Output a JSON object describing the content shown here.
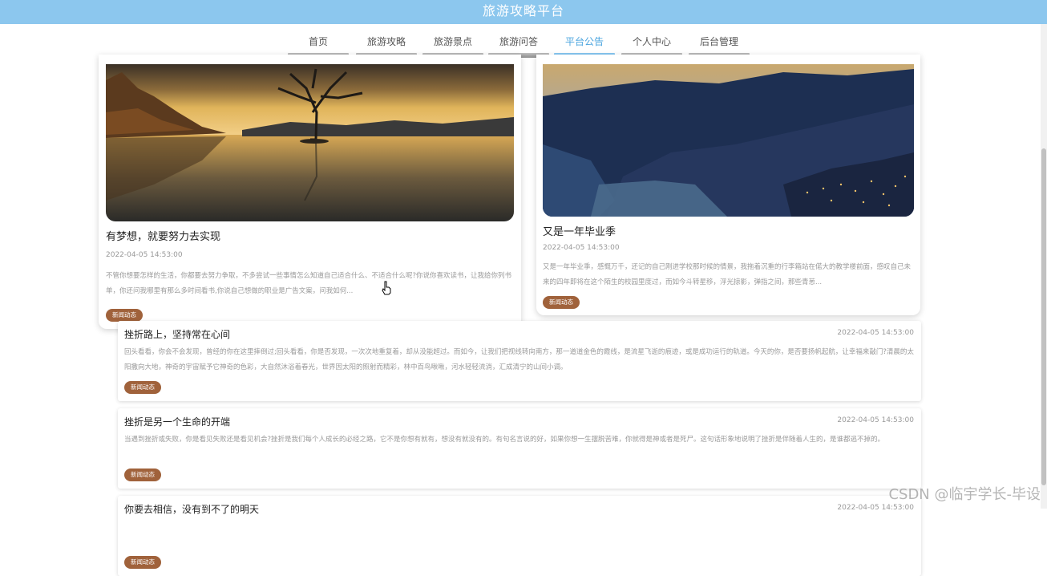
{
  "header": {
    "title": "旅游攻略平台"
  },
  "nav": [
    {
      "label": "首页",
      "active": false
    },
    {
      "label": "旅游攻略",
      "active": false
    },
    {
      "label": "旅游景点",
      "active": false
    },
    {
      "label": "旅游问答",
      "active": false
    },
    {
      "label": "平台公告",
      "active": true
    },
    {
      "label": "个人中心",
      "active": false
    },
    {
      "label": "后台管理",
      "active": false
    }
  ],
  "featured": [
    {
      "title": "有梦想，就要努力去实现",
      "date": "2022-04-05 14:53:00",
      "excerpt": "不管你想要怎样的生活，你都要去努力争取，不多尝试一些事情怎么知道自己适合什么、不适合什么呢?你说你喜欢读书，让我给你列书单，你还问我哪里有那么多时间看书,你说自己想做的职业是广告文案，问我如何...",
      "tag": "新闻动态",
      "image": "lone-tree-lake-sunset"
    },
    {
      "title": "又是一年毕业季",
      "date": "2022-04-05 14:53:00",
      "excerpt": "又是一年毕业季，感慨万千，还记的自己刚进学校那时候的情景，我拖着沉重的行李箱站在偌大的教学楼前面，感叹自己未来的四年即将在这个陌生的校园里度过，而如今斗转星移，浮光掠影，弹指之间，那些青葱...",
      "tag": "新闻动态",
      "image": "mountain-lake-town-dusk"
    }
  ],
  "list": [
    {
      "title": "挫折路上，坚持常在心间",
      "date": "2022-04-05 14:53:00",
      "excerpt": "回头看看，你会不会发现，曾经的你在这里摔倒过;回头看看，你是否发现，一次次地重复着，却从没能超过。而如今，让我们把视线转向南方，那一道道金色的霞线，是流星飞逝的痕迹，或是成功运行的轨道。今天的你，是否要扬帆起航，让幸福来敲门?清晨的太阳撒向大地，神奇的宇宙赋予它神奇的色彩，大自然沐浴着春光，世界因太阳的照射而精彩，林中百鸟啾啾，河水轻轻流淌，汇成清宁的山间小调。",
      "tag": "新闻动态"
    },
    {
      "title": "挫折是另一个生命的开端",
      "date": "2022-04-05 14:53:00",
      "excerpt": "当遇到挫折或失败，你是看见失败还是看见机会?挫折是我们每个人成长的必经之路，它不是你想有就有，想没有就没有的。有句名言说的好，如果你想一生摆脱苦难，你就得是神或者是死尸。这句话形象地说明了挫折是伴随着人生的，是谁都逃不掉的。",
      "tag": "新闻动态"
    },
    {
      "title": "你要去相信，没有到不了的明天",
      "date": "2022-04-05 14:53:00",
      "excerpt": "",
      "tag": "新闻动态"
    }
  ],
  "watermark": "CSDN @临宇学长-毕设"
}
